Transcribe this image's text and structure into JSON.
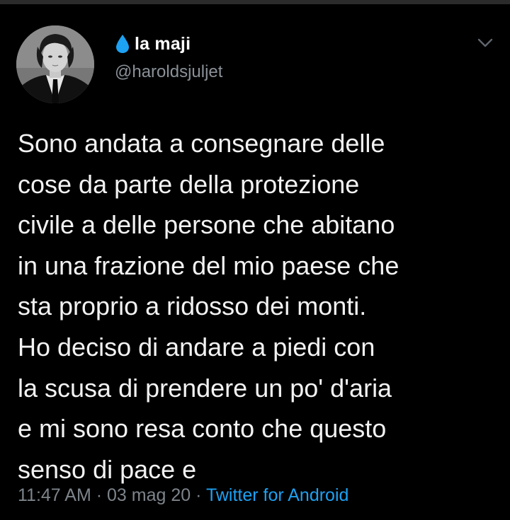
{
  "tweet": {
    "author": {
      "display_name": "la maji",
      "handle": "@haroldsjuljet",
      "name_prefix_icon": "water-drop-icon",
      "avatar_icon": "profile-photo"
    },
    "menu_icon": "chevron-down-icon",
    "text": "Sono andata a consegnare delle\ncose da parte della protezione\ncivile a delle persone che abitano\nin una frazione del mio paese che\nsta proprio a ridosso dei monti.\nHo deciso di andare a piedi con\nla scusa di prendere un po' d'aria\ne mi sono resa conto che questo\nsenso di pace e",
    "time": "11:47 AM",
    "separator": "·",
    "date": "03 mag 20",
    "source": "Twitter for Android"
  },
  "colors": {
    "background": "#000000",
    "text": "#f2f2f2",
    "secondary_text": "#7d848b",
    "link": "#1da1f2",
    "drop_icon": "#1da1f2"
  }
}
